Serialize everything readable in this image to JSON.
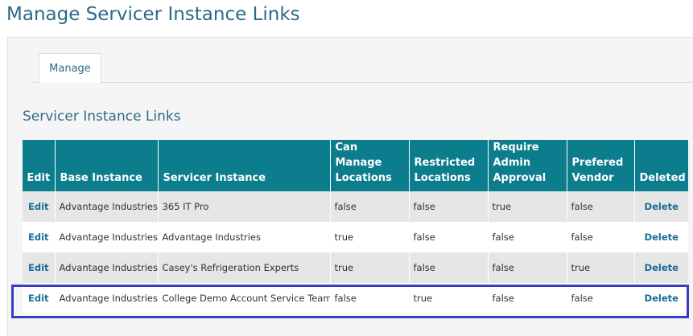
{
  "page": {
    "title": "Manage Servicer Instance Links"
  },
  "tabs": [
    {
      "label": "Manage"
    }
  ],
  "section": {
    "title": "Servicer Instance Links"
  },
  "table": {
    "headers": {
      "edit": "Edit",
      "base": "Base Instance",
      "servicer": "Servicer Instance",
      "can_manage_1": "Can Manage",
      "can_manage_2": "Locations",
      "restricted_1": "Restricted",
      "restricted_2": "Locations",
      "require_1": "Require",
      "require_2": "Admin",
      "require_3": "Approval",
      "prefered_1": "Prefered",
      "prefered_2": "Vendor",
      "deleted": "Deleted"
    },
    "rows": [
      {
        "edit": "Edit",
        "base": "Advantage Industries",
        "servicer": "365 IT Pro",
        "can_manage": "false",
        "restricted": "false",
        "require_admin": "true",
        "prefered": "false",
        "delete": "Delete"
      },
      {
        "edit": "Edit",
        "base": "Advantage Industries",
        "servicer": "Advantage Industries",
        "can_manage": "true",
        "restricted": "false",
        "require_admin": "false",
        "prefered": "false",
        "delete": "Delete"
      },
      {
        "edit": "Edit",
        "base": "Advantage Industries",
        "servicer": "Casey's Refrigeration Experts",
        "can_manage": "true",
        "restricted": "false",
        "require_admin": "false",
        "prefered": "true",
        "delete": "Delete"
      },
      {
        "edit": "Edit",
        "base": "Advantage Industries",
        "servicer": "College Demo Account Service Team",
        "can_manage": "false",
        "restricted": "true",
        "require_admin": "false",
        "prefered": "false",
        "delete": "Delete"
      }
    ]
  },
  "colors": {
    "header_bg": "#0c7d8d",
    "title": "#2b6b87",
    "link": "#1a6c96",
    "highlight": "#3a3cc4",
    "row_alt": "#e6e6e6"
  }
}
